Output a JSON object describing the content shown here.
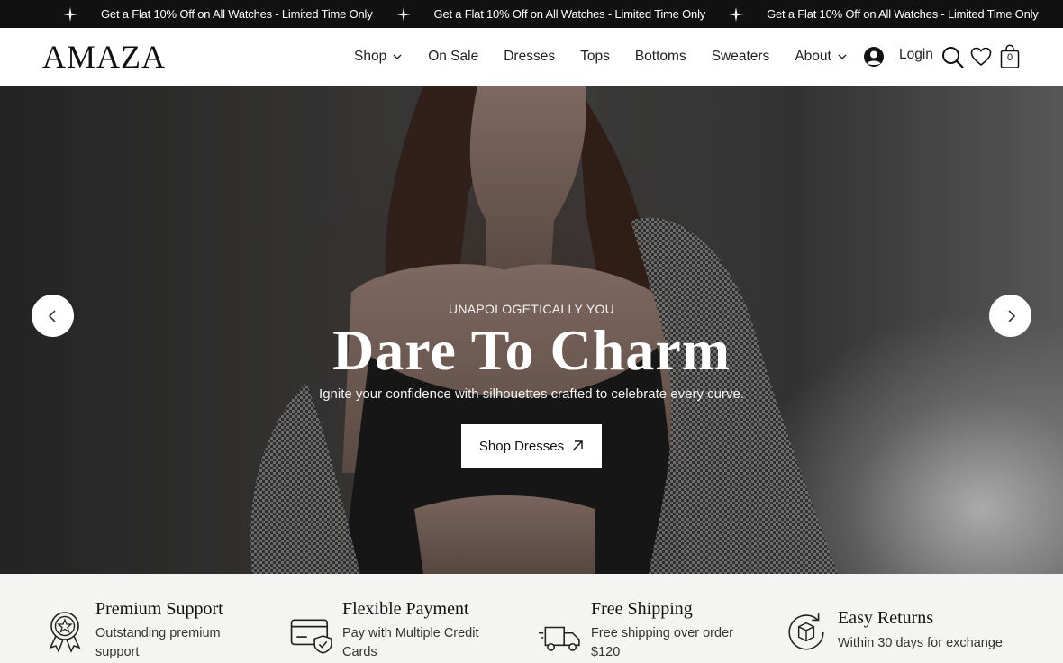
{
  "announcement": {
    "items": [
      "Get a Flat 10% Off on All Watches - Limited Time Only",
      "Get a Flat 10% Off on All Watches - Limited Time Only",
      "Get a Flat 10% Off on All Watches - Limited Time Only"
    ],
    "icon": "sparkle-icon"
  },
  "header": {
    "logo": "AMAZA",
    "nav": [
      {
        "label": "Shop",
        "dropdown": true
      },
      {
        "label": "On Sale",
        "dropdown": false
      },
      {
        "label": "Dresses",
        "dropdown": false
      },
      {
        "label": "Tops",
        "dropdown": false
      },
      {
        "label": "Bottoms",
        "dropdown": false
      },
      {
        "label": "Sweaters",
        "dropdown": false
      },
      {
        "label": "About",
        "dropdown": true
      }
    ],
    "login_label": "Login",
    "cart_count": "0"
  },
  "hero": {
    "eyebrow": "UNAPOLOGETICALLY YOU",
    "headline": "Dare To Charm",
    "subline": "Ignite your confidence with silhouettes crafted to celebrate every curve.",
    "cta_label": "Shop Dresses"
  },
  "features": [
    {
      "icon": "award-ribbon-icon",
      "title": "Premium Support",
      "desc": "Outstanding premium support"
    },
    {
      "icon": "credit-card-check-icon",
      "title": "Flexible Payment",
      "desc": "Pay with Multiple Credit Cards"
    },
    {
      "icon": "delivery-truck-icon",
      "title": "Free Shipping",
      "desc": "Free shipping over order $120"
    },
    {
      "icon": "return-box-icon",
      "title": "Easy Returns",
      "desc": "Within 30 days for exchange"
    }
  ],
  "colors": {
    "announcement_bg": "#111111",
    "features_bg": "#f4f4f3",
    "text_dark": "#111111"
  }
}
